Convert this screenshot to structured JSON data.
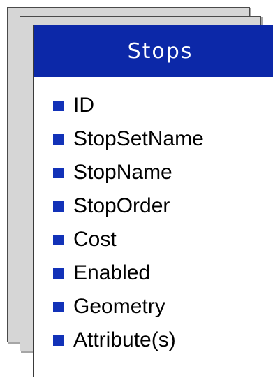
{
  "card": {
    "title": "Stops",
    "fields": [
      "ID",
      "StopSetName",
      "StopName",
      "StopOrder",
      "Cost",
      "Enabled",
      "Geometry",
      "Attribute(s)"
    ]
  },
  "colors": {
    "header_background": "#0c28a8",
    "bullet": "#1232b8",
    "stacked_cards": "#d6d6d6"
  }
}
